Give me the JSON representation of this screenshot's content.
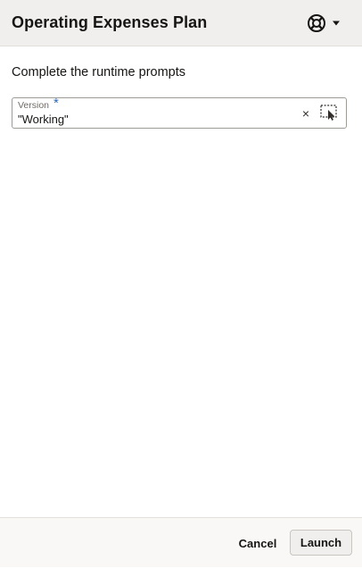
{
  "header": {
    "title": "Operating Expenses Plan",
    "help_icon": "lifebuoy-help-icon",
    "menu_icon": "caret-down-icon"
  },
  "main": {
    "heading": "Complete the runtime prompts",
    "prompt": {
      "label": "Version",
      "required_marker": "*",
      "value": "\"Working\"",
      "clear_icon": "close-x-icon",
      "clear_glyph": "×",
      "select_icon": "member-selector-icon"
    }
  },
  "footer": {
    "cancel_label": "Cancel",
    "launch_label": "Launch"
  },
  "colors": {
    "header_bg": "#f1efed",
    "required_marker": "#2c6ab8",
    "footer_bg": "#f9f8f7"
  }
}
